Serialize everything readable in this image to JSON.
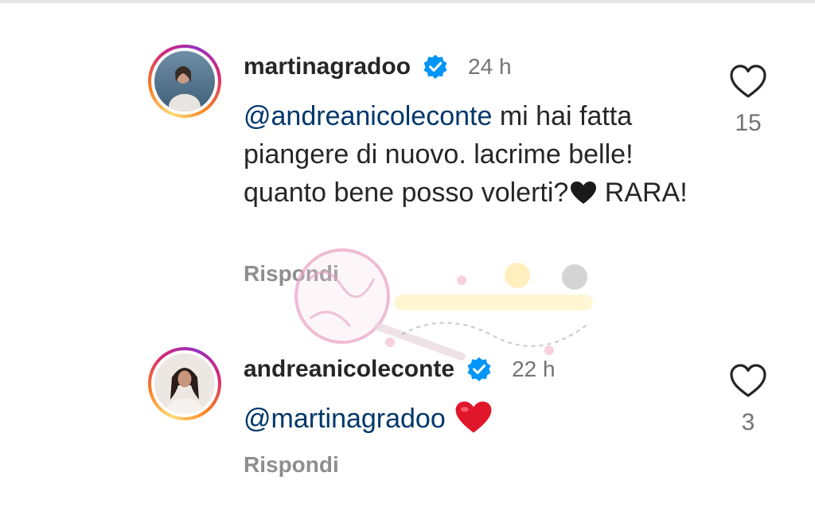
{
  "comments": [
    {
      "username": "martinagradoo",
      "verified": true,
      "time": "24 h",
      "mention": "@andreanicoleconte",
      "text_after_mention": " mi hai fatta piangere di nuovo. lacrime belle! quanto bene posso volerti?",
      "emoji": "black-heart",
      "text_end": " RARA!",
      "reply_label": "Rispondi",
      "like_count": "15"
    },
    {
      "username": "andreanicoleconte",
      "verified": true,
      "time": "22 h",
      "mention": "@martinagradoo",
      "text_after_mention": " ",
      "emoji": "red-heart",
      "reply_label": "Rispondi",
      "like_count": "3"
    }
  ],
  "colors": {
    "mention": "#00376b",
    "verified": "#0095f6",
    "muted": "#737373"
  },
  "icons": {
    "like": "heart-outline-icon",
    "verified": "verified-badge-icon"
  }
}
